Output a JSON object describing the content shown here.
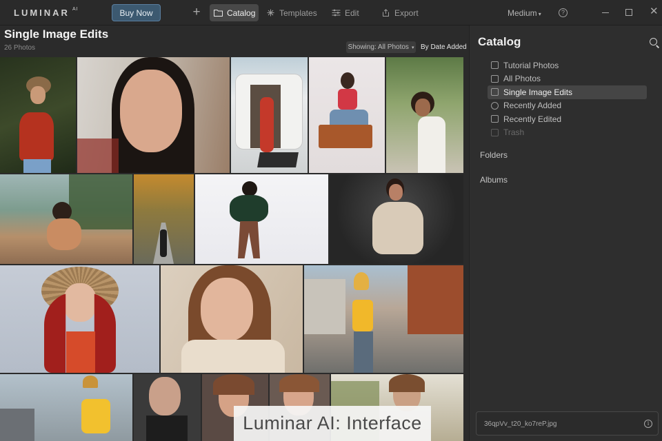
{
  "app": {
    "logo": "LUMINAR",
    "logo_suffix": "AI",
    "buy_label": "Buy Now",
    "plus_label": "+",
    "nav": [
      {
        "label": "Catalog",
        "icon": "folder-icon"
      },
      {
        "label": "Templates",
        "icon": "sparkle-icon"
      },
      {
        "label": "Edit",
        "icon": "sliders-icon"
      },
      {
        "label": "Export",
        "icon": "share-icon"
      }
    ],
    "view_size": "Medium",
    "help_label": "?",
    "close_label": "✕"
  },
  "main": {
    "title": "Single Image Edits",
    "count": "26 Photos",
    "filter_label": "Showing: All Photos",
    "sort_label": "By Date Added"
  },
  "panel": {
    "title": "Catalog",
    "items": [
      {
        "label": "Tutorial Photos",
        "icon": "graduation-cap-icon",
        "state": "normal"
      },
      {
        "label": "All Photos",
        "icon": "stack-icon",
        "state": "normal"
      },
      {
        "label": "Single Image Edits",
        "icon": "grid-icon",
        "state": "active"
      },
      {
        "label": "Recently Added",
        "icon": "plus-circle-icon",
        "state": "normal"
      },
      {
        "label": "Recently Edited",
        "icon": "sliders-icon",
        "state": "normal"
      },
      {
        "label": "Trash",
        "icon": "trash-icon",
        "state": "disabled"
      }
    ],
    "folders_label": "Folders",
    "albums_label": "Albums",
    "file_name": "36qpVv_t20_ko7reP.jpg",
    "info_label": "i"
  },
  "caption": "Luminar AI: Interface",
  "colors": {
    "background": "#2b2b2b",
    "panel": "#2e2e2e",
    "accent_button": "#3c5970",
    "active_item": "#454545"
  }
}
